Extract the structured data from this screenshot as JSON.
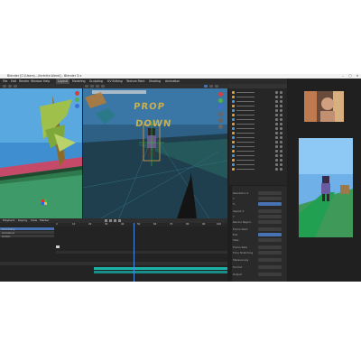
{
  "window": {
    "title": "Blender [C:\\Users\\...\\fortnite.blend] - Blender 3.x",
    "controls": [
      "–",
      "□",
      "✕"
    ]
  },
  "menubar": {
    "items": [
      "File",
      "Edit",
      "Render",
      "Window",
      "Help",
      "Layout",
      "Modeling",
      "Sculpting",
      "UV Editing",
      "Texture Paint",
      "Shading",
      "Animation"
    ]
  },
  "scene": {
    "sign_line1": "PROP",
    "sign_line2": "DOWN"
  },
  "timeline": {
    "labels": [
      "Playback",
      "Keying",
      "View",
      "Marker"
    ],
    "frames": [
      "0",
      "10",
      "20",
      "30",
      "40",
      "50",
      "60",
      "70",
      "80",
      "90",
      "100"
    ]
  },
  "dopesheet": {
    "rows": [
      "Summary",
      "Armature",
      "Action"
    ]
  },
  "properties": {
    "rows": [
      {
        "label": "Resolution X",
        "blue": false
      },
      {
        "label": "Y",
        "blue": false
      },
      {
        "label": "%",
        "blue": true
      },
      {
        "label": "Aspect X",
        "blue": false
      },
      {
        "label": "Y",
        "blue": false
      },
      {
        "label": "Render Region",
        "blue": false
      },
      {
        "label": "Frame Start",
        "blue": false
      },
      {
        "label": "End",
        "blue": true
      },
      {
        "label": "Step",
        "blue": false
      },
      {
        "label": "Frame Rate",
        "blue": false
      },
      {
        "label": "Time Stretching",
        "blue": false
      },
      {
        "label": "Stereoscopy",
        "blue": false
      },
      {
        "label": "Format",
        "blue": false
      },
      {
        "label": "Output",
        "blue": false
      }
    ]
  },
  "colors": {
    "sky": "#3f8fd0",
    "ground": "#3f9a6a",
    "accent": "#4772b3",
    "selection": "#e0a040",
    "teal_strip": "#1bb3a8"
  }
}
